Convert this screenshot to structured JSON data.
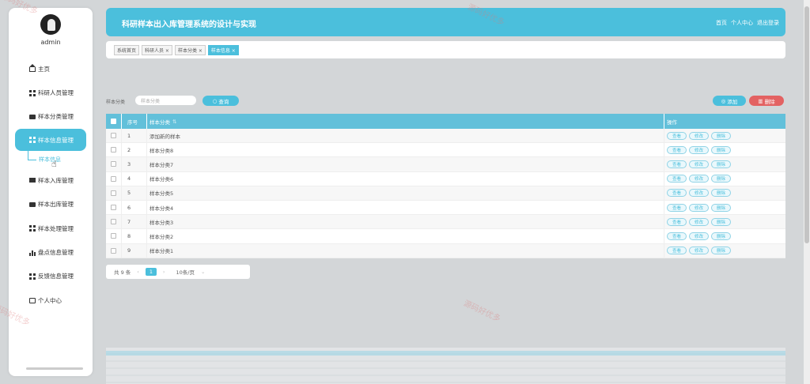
{
  "sidebar": {
    "username": "admin",
    "items": [
      {
        "label": "主页",
        "icon": "home-icon"
      },
      {
        "label": "科研人员管理",
        "icon": "grid-icon"
      },
      {
        "label": "样本分类管理",
        "icon": "monitor-icon"
      },
      {
        "label": "样本信息管理",
        "icon": "grid-icon"
      },
      {
        "label": "样本入库管理",
        "icon": "card-icon"
      },
      {
        "label": "样本出库管理",
        "icon": "monitor-icon"
      },
      {
        "label": "样本处理管理",
        "icon": "grid-icon"
      },
      {
        "label": "盘点信息管理",
        "icon": "bar-chart-icon"
      },
      {
        "label": "反馈信息管理",
        "icon": "grid-icon"
      },
      {
        "label": "个人中心",
        "icon": "user-card-icon"
      }
    ],
    "active_sub": "样本信息"
  },
  "header": {
    "title": "科研样本出入库管理系统的设计与实现",
    "links": [
      "首页",
      "个人中心",
      "退出登录"
    ]
  },
  "tabs": [
    {
      "label": "系统首页",
      "active": false
    },
    {
      "label": "科研人员 ×",
      "active": false
    },
    {
      "label": "样本分类 ×",
      "active": false
    },
    {
      "label": "样本信息 ×",
      "active": true
    }
  ],
  "search": {
    "label": "样本分类",
    "placeholder": "样本分类",
    "button": "查询",
    "add_button": "添加",
    "delete_button": "删除"
  },
  "table": {
    "columns": [
      "序号",
      "样本分类",
      "操作"
    ],
    "rows": [
      {
        "no": "1",
        "name": "添加新的样本"
      },
      {
        "no": "2",
        "name": "样本分类8"
      },
      {
        "no": "3",
        "name": "样本分类7"
      },
      {
        "no": "4",
        "name": "样本分类6"
      },
      {
        "no": "5",
        "name": "样本分类5"
      },
      {
        "no": "6",
        "name": "样本分类4"
      },
      {
        "no": "7",
        "name": "样本分类3"
      },
      {
        "no": "8",
        "name": "样本分类2"
      },
      {
        "no": "9",
        "name": "样本分类1"
      }
    ],
    "actions": [
      "查看",
      "修改",
      "删除"
    ]
  },
  "pager": {
    "total": "共 9 条",
    "prev": "‹",
    "current": "1",
    "next": "›",
    "page_size": "10条/页"
  },
  "watermark": "源码好优多"
}
